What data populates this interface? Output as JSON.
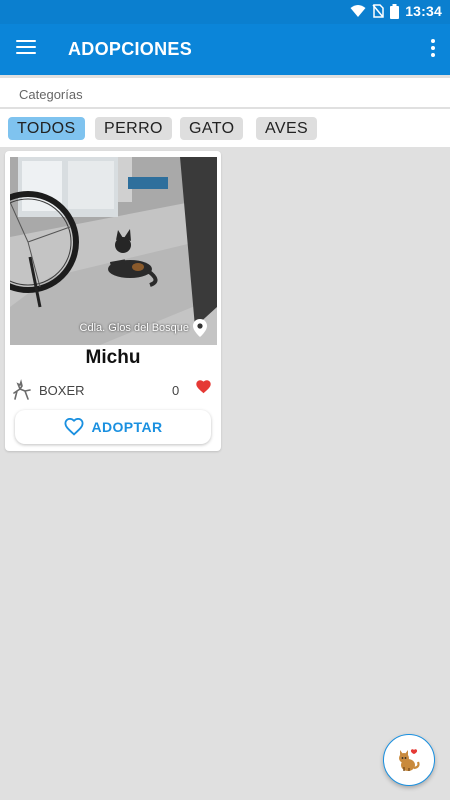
{
  "status_bar": {
    "time": "13:34"
  },
  "app_bar": {
    "title": "ADOPCIONES"
  },
  "categories": {
    "label": "Categorías",
    "chips": [
      {
        "label": "TODOS",
        "active": true
      },
      {
        "label": "PERRO",
        "active": false
      },
      {
        "label": "GATO",
        "active": false
      },
      {
        "label": "AVES",
        "active": false
      }
    ]
  },
  "pets": [
    {
      "name": "Michu",
      "location": "Cdla. Glos del Bosque",
      "breed": "BOXER",
      "likes": "0",
      "adopt_label": "ADOPTAR"
    }
  ],
  "colors": {
    "primary": "#0b85d9",
    "status_bar": "#0b7fcf",
    "chip_active": "#7fc3ef",
    "accent_blue": "#1a90e0",
    "heart_red": "#e53935"
  },
  "icons": {
    "menu": "menu-icon",
    "more": "more-vert-icon",
    "location": "location-pin-icon",
    "breed": "dog-icon",
    "like": "heart-icon",
    "adopt": "heart-outline-icon",
    "fab": "cat-heart-icon"
  }
}
